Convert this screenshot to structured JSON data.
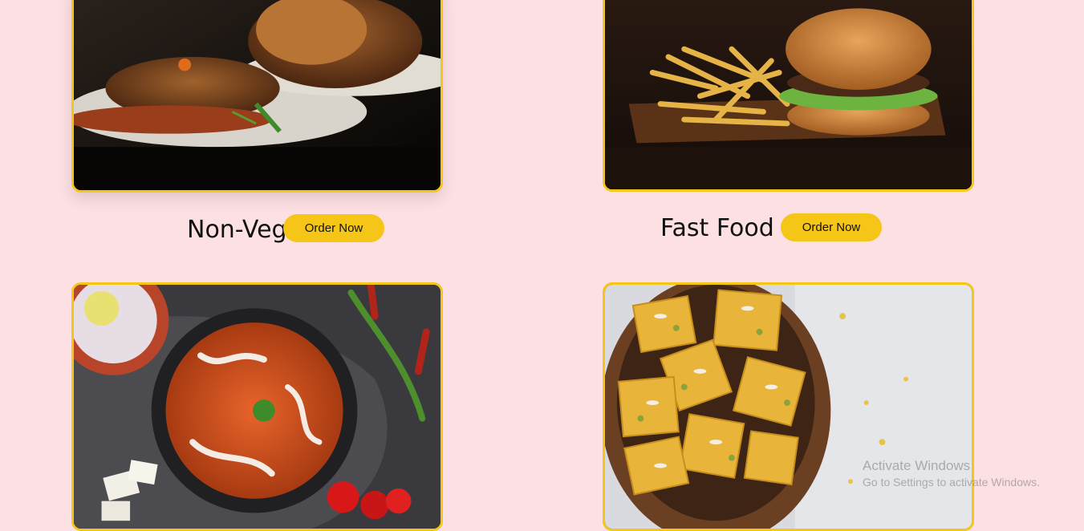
{
  "cards": [
    {
      "label": "Non-Veg",
      "button_label": "Order Now",
      "image": "roast-chicken-plate-photo"
    },
    {
      "label": "Fast Food",
      "button_label": "Order Now",
      "image": "burger-and-fries-photo"
    },
    {
      "image": "paneer-curry-bowl-photo"
    },
    {
      "image": "sweet-barfi-bowl-photo"
    }
  ],
  "watermark": {
    "title": "Activate Windows",
    "subtitle": "Go to Settings to activate Windows."
  },
  "colors": {
    "background": "#fde0e3",
    "accent": "#f5c518",
    "text": "#111111"
  }
}
